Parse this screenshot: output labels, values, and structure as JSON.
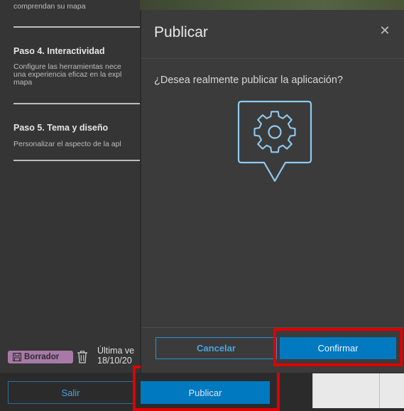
{
  "sidebar": {
    "top_fragment": "comprendan su mapa",
    "step4": {
      "title": "Paso 4. Interactividad",
      "desc_lines": [
        "Configure las herramientas nece",
        "una experiencia eficaz en la expl",
        "mapa"
      ]
    },
    "step5": {
      "title": "Paso 5. Tema y diseño",
      "desc_lines": [
        "Personalizar el aspecto de la apl"
      ]
    },
    "draft_badge": "Borrador",
    "last_saved_lines": [
      "Última ve",
      "18/10/20"
    ]
  },
  "footer": {
    "exit_label": "Salir",
    "publish_label": "Publicar"
  },
  "modal": {
    "title": "Publicar",
    "close_symbol": "✕",
    "question": "¿Desea realmente publicar la aplicación?",
    "cancel_label": "Cancelar",
    "confirm_label": "Confirmar"
  },
  "colors": {
    "accent_blue": "#0079c1",
    "highlight_red": "#e00000",
    "draft_badge": "#a779a8"
  },
  "icons": [
    "save-icon",
    "trash-icon",
    "close-icon",
    "gear-icon"
  ]
}
